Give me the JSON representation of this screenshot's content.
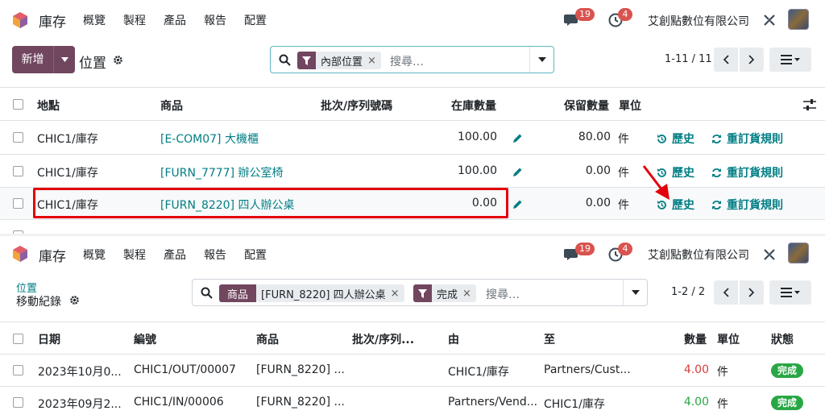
{
  "app": {
    "name": "庫存",
    "menu": [
      "概覽",
      "製程",
      "產品",
      "報告",
      "配置"
    ],
    "chat_count": "19",
    "activity_count": "4",
    "company": "艾創點數位有限公司"
  },
  "view1": {
    "new_label": "新增",
    "title": "位置",
    "search": {
      "facet_value": "內部位置",
      "placeholder": "搜尋…"
    },
    "pager": "1-11 / 11",
    "columns": [
      "地點",
      "商品",
      "批次/序列號碼",
      "在庫數量",
      "保留數量",
      "單位"
    ],
    "rows": [
      {
        "location": "CHIC1/庫存",
        "product": "[E-COM07] 大機櫃",
        "onhand": "100.00",
        "reserved": "80.00",
        "uom": "件",
        "history": "歷史",
        "reorder": "重訂貨規則"
      },
      {
        "location": "CHIC1/庫存",
        "product": "[FURN_7777] 辦公室椅",
        "onhand": "100.00",
        "reserved": "0.00",
        "uom": "件",
        "history": "歷史",
        "reorder": "重訂貨規則"
      },
      {
        "location": "CHIC1/庫存",
        "product": "[FURN_8220] 四人辦公桌",
        "onhand": "0.00",
        "reserved": "0.00",
        "uom": "件",
        "history": "歷史",
        "reorder": "重訂貨規則"
      }
    ]
  },
  "view2": {
    "breadcrumb_parent": "位置",
    "title": "移動紀錄",
    "search": {
      "facet1_label": "商品",
      "facet1_value": "[FURN_8220] 四人辦公桌",
      "facet2_value": "完成",
      "placeholder": "搜尋…"
    },
    "pager": "1-2 / 2",
    "columns": [
      "日期",
      "編號",
      "商品",
      "批次/序列...",
      "由",
      "至",
      "數量",
      "單位",
      "狀態"
    ],
    "rows": [
      {
        "date": "2023年10月0...",
        "ref": "CHIC1/OUT/00007",
        "product": "[FURN_8220] ...",
        "from": "CHIC1/庫存",
        "to": "Partners/Cust...",
        "qty": "4.00",
        "uom": "件",
        "status": "完成"
      },
      {
        "date": "2023年09月2...",
        "ref": "CHIC1/IN/00006",
        "product": "[FURN_8220] ...",
        "from": "Partners/Vend...",
        "to": "CHIC1/庫存",
        "qty": "4.00",
        "uom": "件",
        "status": "完成"
      }
    ]
  },
  "colors": {
    "brand": "#71465f",
    "link": "#017e84",
    "highlight": "#e3000b",
    "badge": "#d9534f",
    "done": "#28a745"
  }
}
